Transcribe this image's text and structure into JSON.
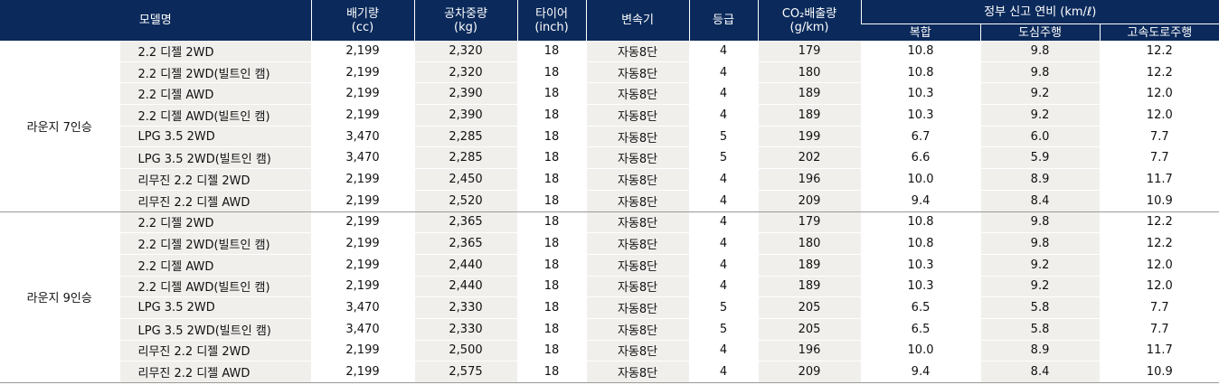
{
  "header": {
    "model": "모델명",
    "displacement": [
      "배기량",
      "(cc)"
    ],
    "curb_weight": [
      "공차중량",
      "(kg)"
    ],
    "tire": [
      "타이어",
      "(inch)"
    ],
    "transmission": "변속기",
    "grade": "등급",
    "co2": [
      "CO₂배출량",
      "(g/km)"
    ],
    "fuel_economy": "정부 신고 연비 (km/ℓ)",
    "combined": "복합",
    "city": "도심주행",
    "highway": "고속도로주행"
  },
  "groups": [
    {
      "name": "라운지 7인승",
      "rows": [
        [
          "2.2 디젤 2WD",
          "2,199",
          "2,320",
          "18",
          "자동8단",
          "4",
          "179",
          "10.8",
          "9.8",
          "12.2"
        ],
        [
          "2.2 디젤 2WD(빌트인 캠)",
          "2,199",
          "2,320",
          "18",
          "자동8단",
          "4",
          "180",
          "10.8",
          "9.8",
          "12.2"
        ],
        [
          "2.2 디젤 AWD",
          "2,199",
          "2,390",
          "18",
          "자동8단",
          "4",
          "189",
          "10.3",
          "9.2",
          "12.0"
        ],
        [
          "2.2 디젤 AWD(빌트인 캠)",
          "2,199",
          "2,390",
          "18",
          "자동8단",
          "4",
          "189",
          "10.3",
          "9.2",
          "12.0"
        ],
        [
          "LPG 3.5 2WD",
          "3,470",
          "2,285",
          "18",
          "자동8단",
          "5",
          "199",
          "6.7",
          "6.0",
          "7.7"
        ],
        [
          "LPG 3.5 2WD(빌트인 캠)",
          "3,470",
          "2,285",
          "18",
          "자동8단",
          "5",
          "202",
          "6.6",
          "5.9",
          "7.7"
        ],
        [
          "리무진 2.2 디젤 2WD",
          "2,199",
          "2,450",
          "18",
          "자동8단",
          "4",
          "196",
          "10.0",
          "8.9",
          "11.7"
        ],
        [
          "리무진 2.2 디젤 AWD",
          "2,199",
          "2,520",
          "18",
          "자동8단",
          "4",
          "209",
          "9.4",
          "8.4",
          "10.9"
        ]
      ]
    },
    {
      "name": "라운지 9인승",
      "rows": [
        [
          "2.2 디젤 2WD",
          "2,199",
          "2,365",
          "18",
          "자동8단",
          "4",
          "179",
          "10.8",
          "9.8",
          "12.2"
        ],
        [
          "2.2 디젤 2WD(빌트인 캠)",
          "2,199",
          "2,365",
          "18",
          "자동8단",
          "4",
          "180",
          "10.8",
          "9.8",
          "12.2"
        ],
        [
          "2.2 디젤 AWD",
          "2,199",
          "2,440",
          "18",
          "자동8단",
          "4",
          "189",
          "10.3",
          "9.2",
          "12.0"
        ],
        [
          "2.2 디젤 AWD(빌트인 캠)",
          "2,199",
          "2,440",
          "18",
          "자동8단",
          "4",
          "189",
          "10.3",
          "9.2",
          "12.0"
        ],
        [
          "LPG 3.5 2WD",
          "3,470",
          "2,330",
          "18",
          "자동8단",
          "5",
          "205",
          "6.5",
          "5.8",
          "7.7"
        ],
        [
          "LPG 3.5 2WD(빌트인 캠)",
          "3,470",
          "2,330",
          "18",
          "자동8단",
          "5",
          "205",
          "6.5",
          "5.8",
          "7.7"
        ],
        [
          "리무진 2.2 디젤 2WD",
          "2,199",
          "2,500",
          "18",
          "자동8단",
          "4",
          "196",
          "10.0",
          "8.9",
          "11.7"
        ],
        [
          "리무진 2.2 디젤 AWD",
          "2,199",
          "2,575",
          "18",
          "자동8단",
          "4",
          "209",
          "9.4",
          "8.4",
          "10.9"
        ]
      ]
    }
  ]
}
